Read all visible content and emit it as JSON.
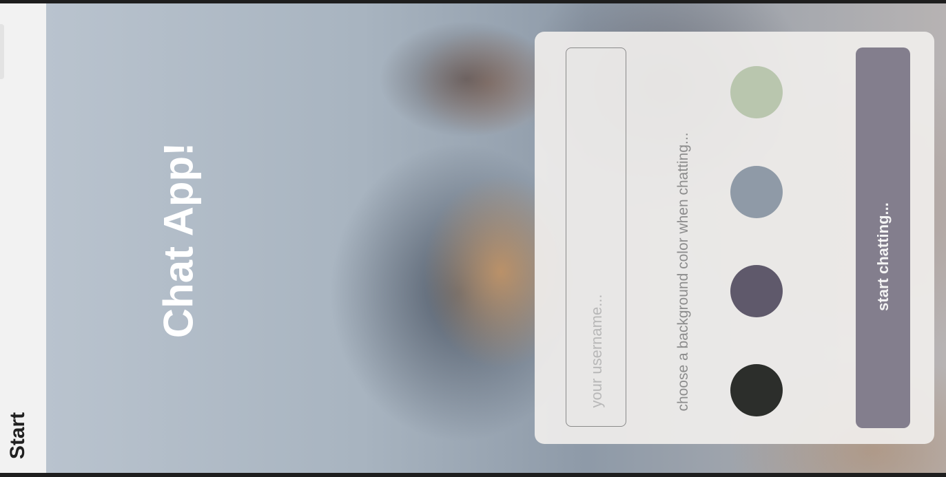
{
  "appbar": {
    "title": "Start"
  },
  "app_title": "Chat App!",
  "form": {
    "username_placeholder": "your username...",
    "color_prompt": "choose a background color when chatting...",
    "colors": [
      "#b9c6ae",
      "#8f9aa7",
      "#5f596b",
      "#2c2e2b"
    ],
    "start_label": "start chatting..."
  }
}
